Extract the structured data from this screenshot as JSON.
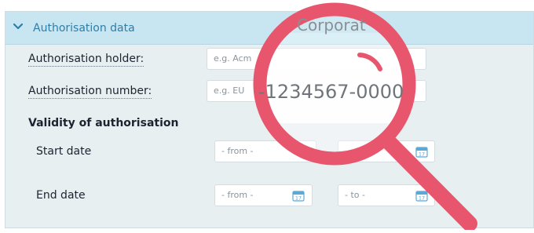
{
  "panel": {
    "title": "Authorisation data",
    "expanded_icon": "chevron-down-icon"
  },
  "fields": {
    "holder": {
      "label": "Authorisation holder:",
      "placeholder": "e.g. Acm"
    },
    "number": {
      "label": "Authorisation number:",
      "placeholder": "e.g. EU"
    }
  },
  "validity": {
    "title": "Validity of authorisation",
    "start": {
      "label": "Start date",
      "from_placeholder": "- from -"
    },
    "end": {
      "label": "End date",
      "from_placeholder": "- from -",
      "to_placeholder": "- to -"
    },
    "calendar_icon_text": "17"
  },
  "magnifier": {
    "corp_text": "Corporat",
    "number_text": "-1234567-0000"
  },
  "colors": {
    "header_bg": "#c8e6f2",
    "title_color": "#2d7fa8",
    "magnifier": "#e8566e",
    "calendar": "#5aa9d6"
  }
}
